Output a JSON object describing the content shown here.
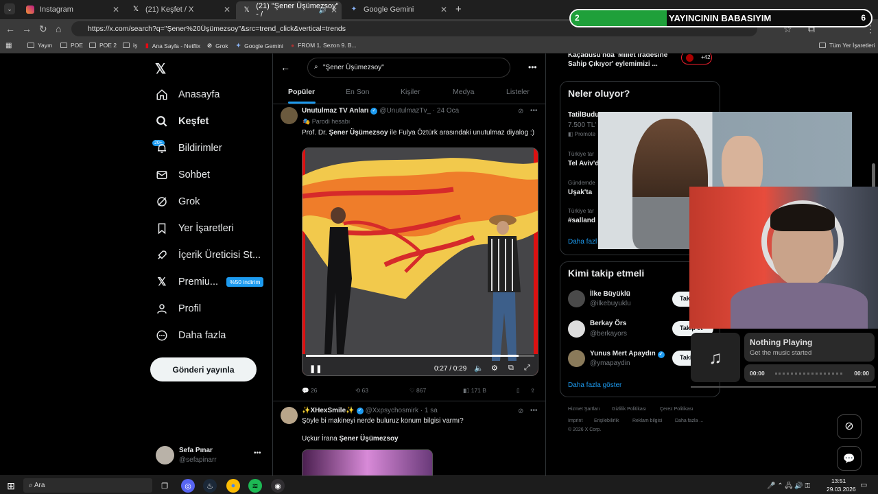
{
  "browser": {
    "tabs": [
      {
        "label": "Instagram",
        "icon": "instagram-icon"
      },
      {
        "label": "(21) Keşfet / X",
        "icon": "x-icon"
      },
      {
        "label": "(21) \"Şener Üşümezsoy\" - /",
        "icon": "x-icon"
      },
      {
        "label": "Google Gemini",
        "icon": "gemini-icon"
      }
    ],
    "url": "https://x.com/search?q=\"Şener%20Üşümezsoy\"&src=trend_click&vertical=trends",
    "bookmarks": [
      "Yayın",
      "POE",
      "POE 2",
      "iş",
      "Ana Sayfa - Netflix",
      "Grok",
      "Google Gemini",
      "FROM 1. Sezon 9. B...",
      "Tüm Yer İşaretleri"
    ]
  },
  "sidebar": {
    "items": [
      {
        "label": "Anasayfa",
        "icon": "home-icon"
      },
      {
        "label": "Keşfet",
        "icon": "search-icon"
      },
      {
        "label": "Bildirimler",
        "icon": "bell-icon"
      },
      {
        "label": "Sohbet",
        "icon": "mail-icon"
      },
      {
        "label": "Grok",
        "icon": "grok-icon"
      },
      {
        "label": "Yer İşaretleri",
        "icon": "bookmark-icon"
      },
      {
        "label": "İçerik Üreticisi St...",
        "icon": "rocket-icon"
      },
      {
        "label": "Premiu...",
        "icon": "x-icon"
      },
      {
        "label": "Profil",
        "icon": "person-icon"
      },
      {
        "label": "Daha fazla",
        "icon": "more-circle-icon"
      }
    ],
    "notif_badge": "20+",
    "premium_promo": "%50 indirim",
    "post_button": "Gönderi yayınla",
    "user": {
      "name": "Sefa Pınar",
      "handle": "@sefapinarr"
    }
  },
  "search": {
    "query": "\"Şener Üşümezsoy\"",
    "tabs": [
      "Popüler",
      "En Son",
      "Kişiler",
      "Medya",
      "Listeler"
    ]
  },
  "tweet1": {
    "author": "Unutulmaz TV Anları",
    "handle": "@UnutulmazTv_",
    "date": "· 24 Oca",
    "label": "Parodi hesabı",
    "text_before": "Prof. Dr. ",
    "text_bold": "Şener Üşümezsoy",
    "text_after": " ile Fulya Öztürk arasındaki unutulmaz diyalog :)",
    "video_time": "0:27 / 0:29",
    "progress": 0.93,
    "replies": "26",
    "reposts": "63",
    "likes": "867",
    "views": "171 B"
  },
  "tweet2": {
    "author": "✨XHexSmile✨",
    "handle": "@Xxpsychosmirk",
    "date": "· 1 sa",
    "text": "Şöyle bi makineyi nerde buluruz konum bilgisi varmı?",
    "line2_before": "Uçkur İrana ",
    "line2_bold": "Şener Üşümezsoy"
  },
  "right": {
    "top_text_1": "Kaçadusu'nda 'Millet iradesine",
    "top_text_2": "Sahip Çıkıyor' eylemimizi ...",
    "top_count": "+42",
    "trends_title": "Neler oluyor?",
    "trends": [
      {
        "meta": "",
        "title": "TatilBudu"
      },
      {
        "meta": "",
        "title": "7.500 TL'"
      },
      {
        "meta": "",
        "title": "Promote"
      },
      {
        "meta": "Türkiye tar",
        "title": "Tel Aviv'd"
      },
      {
        "meta": "Gündemde",
        "title": "Uşak'ta"
      },
      {
        "meta": "Türkiye tar",
        "title": "#salland"
      }
    ],
    "trends_more": "Daha fazl",
    "follow_title": "Kimi takip etmeli",
    "follows": [
      {
        "name": "İlke Büyüklü",
        "handle": "@ilkebuyuklu",
        "btn": "Takip et"
      },
      {
        "name": "Berkay Örs",
        "handle": "@berkayors",
        "btn": "Takip et"
      },
      {
        "name": "Yunus Mert Apaydın",
        "handle": "@ymapaydin",
        "btn": "Takip et"
      }
    ],
    "follow_more": "Daha fazla göster",
    "footer": [
      "Hizmet Şartları",
      "Gizlilik Politikası",
      "Çerez Politikası",
      "Imprint",
      "Erişilebilirlik",
      "Reklam bilgisi",
      "Daha fazla ...",
      "© 2026 X Corp."
    ]
  },
  "overlay": {
    "banner_left": "2",
    "banner_text": "YAYINCININ BABASIYIM",
    "banner_right": "6",
    "music_title": "Nothing Playing",
    "music_sub": "Get the music started",
    "music_start": "00:00",
    "music_end": "00:00"
  },
  "taskbar": {
    "search": "Ara",
    "time": "13:51",
    "date": "29.03.2026"
  },
  "colors": {
    "accent": "#1d9bf0",
    "banner": "#1fa03a"
  }
}
